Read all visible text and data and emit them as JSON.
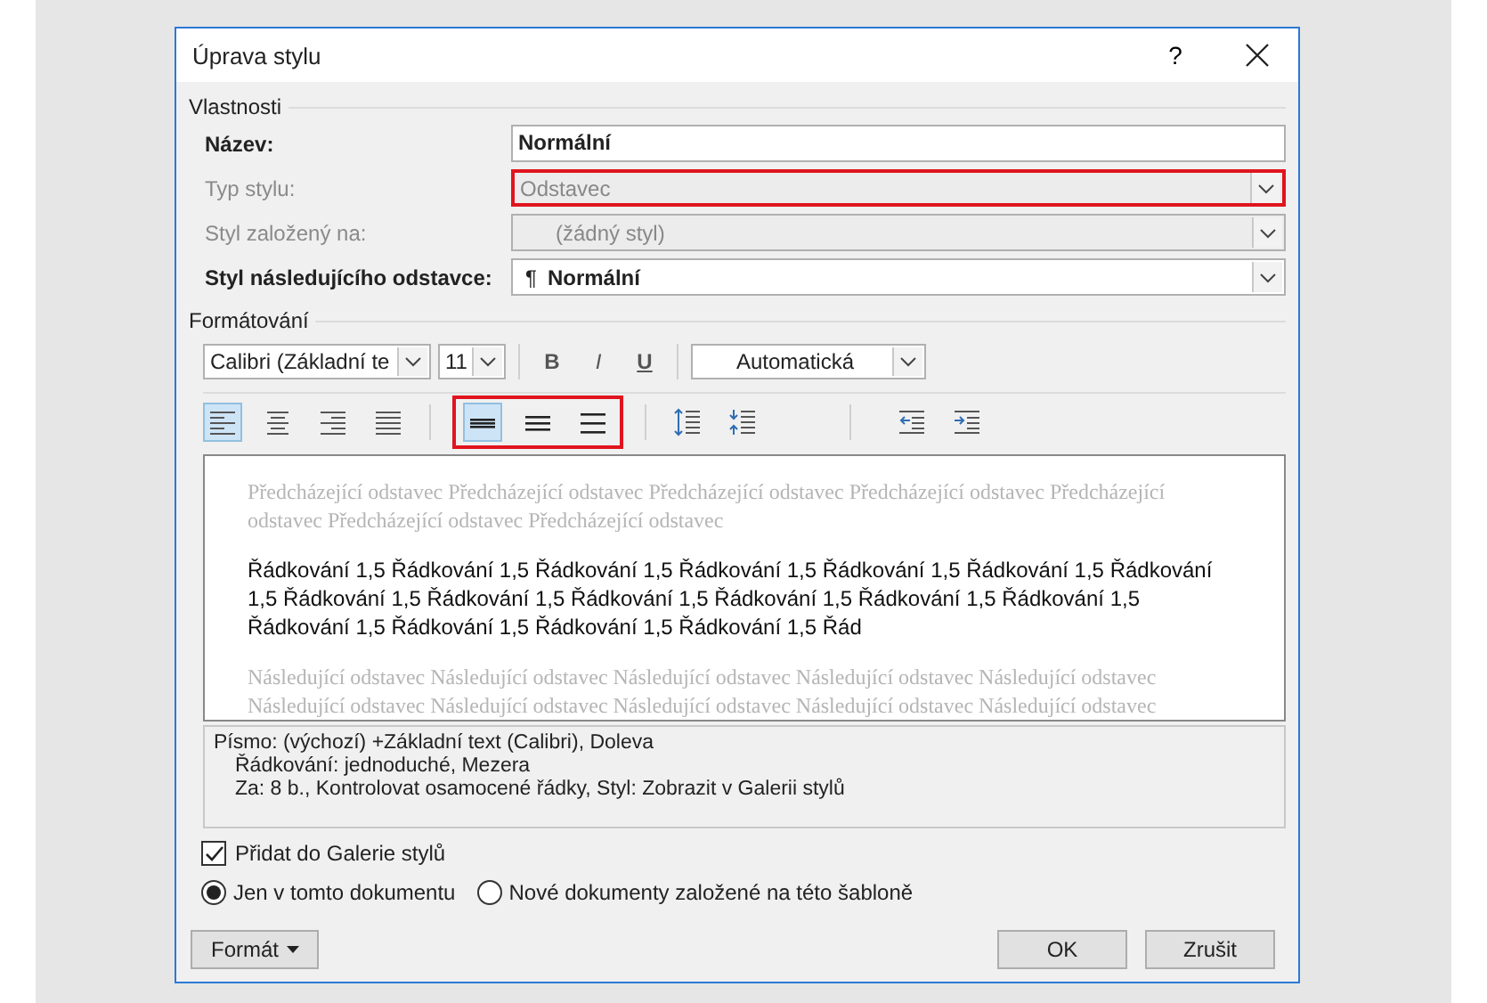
{
  "window": {
    "title": "Úprava stylu",
    "help": "?"
  },
  "properties": {
    "heading": "Vlastnosti",
    "fields": [
      {
        "label": "Název:",
        "kind": "text",
        "value": "Normální",
        "disabled": false
      },
      {
        "label": "Typ stylu:",
        "kind": "select",
        "value": "Odstavec",
        "disabled": true,
        "highlighted": true
      },
      {
        "label": "Styl založený na:",
        "kind": "select",
        "value": "(žádný styl)",
        "disabled": true,
        "highlighted": false
      },
      {
        "label": "Styl následujícího odstavce:",
        "kind": "select",
        "value": "Normální",
        "symbol": "¶",
        "disabled": false,
        "highlighted": false
      }
    ]
  },
  "formatting": {
    "heading": "Formátování",
    "font": "Calibri (Základní te",
    "size": "11",
    "bold": "B",
    "italic": "I",
    "underline": "U",
    "font_color": "Automatická",
    "alignment": [
      {
        "kind": "left",
        "selected": true
      },
      {
        "kind": "center",
        "selected": false
      },
      {
        "kind": "right",
        "selected": false
      },
      {
        "kind": "justify",
        "selected": false
      }
    ],
    "line_spacing": {
      "highlighted": true,
      "items": [
        {
          "kind": "single",
          "selected": true
        },
        {
          "kind": "one-half",
          "selected": false
        },
        {
          "kind": "double",
          "selected": false
        }
      ]
    }
  },
  "preview": {
    "previous": "Předcházející odstavec Předcházející odstavec Předcházející odstavec Předcházející odstavec Předcházející odstavec Předcházející odstavec Předcházející odstavec",
    "sample": "Řádkování 1,5 Řádkování 1,5 Řádkování 1,5 Řádkování 1,5 Řádkování 1,5 Řádkování 1,5 Řádkování 1,5 Řádkování 1,5 Řádkování 1,5 Řádkování 1,5 Řádkování 1,5 Řádkování 1,5 Řádkování 1,5 Řádkování 1,5 Řádkování 1,5 Řádkování 1,5 Řádkování 1,5 Řád",
    "following": "Následující odstavec Následující odstavec Následující odstavec Následující odstavec Následující odstavec Následující odstavec Následující odstavec Následující odstavec Následující odstavec Následující odstavec"
  },
  "description": [
    "Písmo: (výchozí) +Základní text (Calibri), Doleva",
    "Řádkování:  jednoduché, Mezera",
    "Za:  8 b., Kontrolovat osamocené řádky, Styl: Zobrazit v Galerii stylů"
  ],
  "gallery_checkbox": {
    "label": "Přidat do Galerie stylů",
    "checked": true
  },
  "scope": [
    {
      "label": "Jen v tomto dokumentu",
      "selected": true
    },
    {
      "label": "Nové dokumenty založené na této šabloně",
      "selected": false
    }
  ],
  "buttons": {
    "format": "Formát",
    "ok": "OK",
    "cancel": "Zrušit"
  }
}
